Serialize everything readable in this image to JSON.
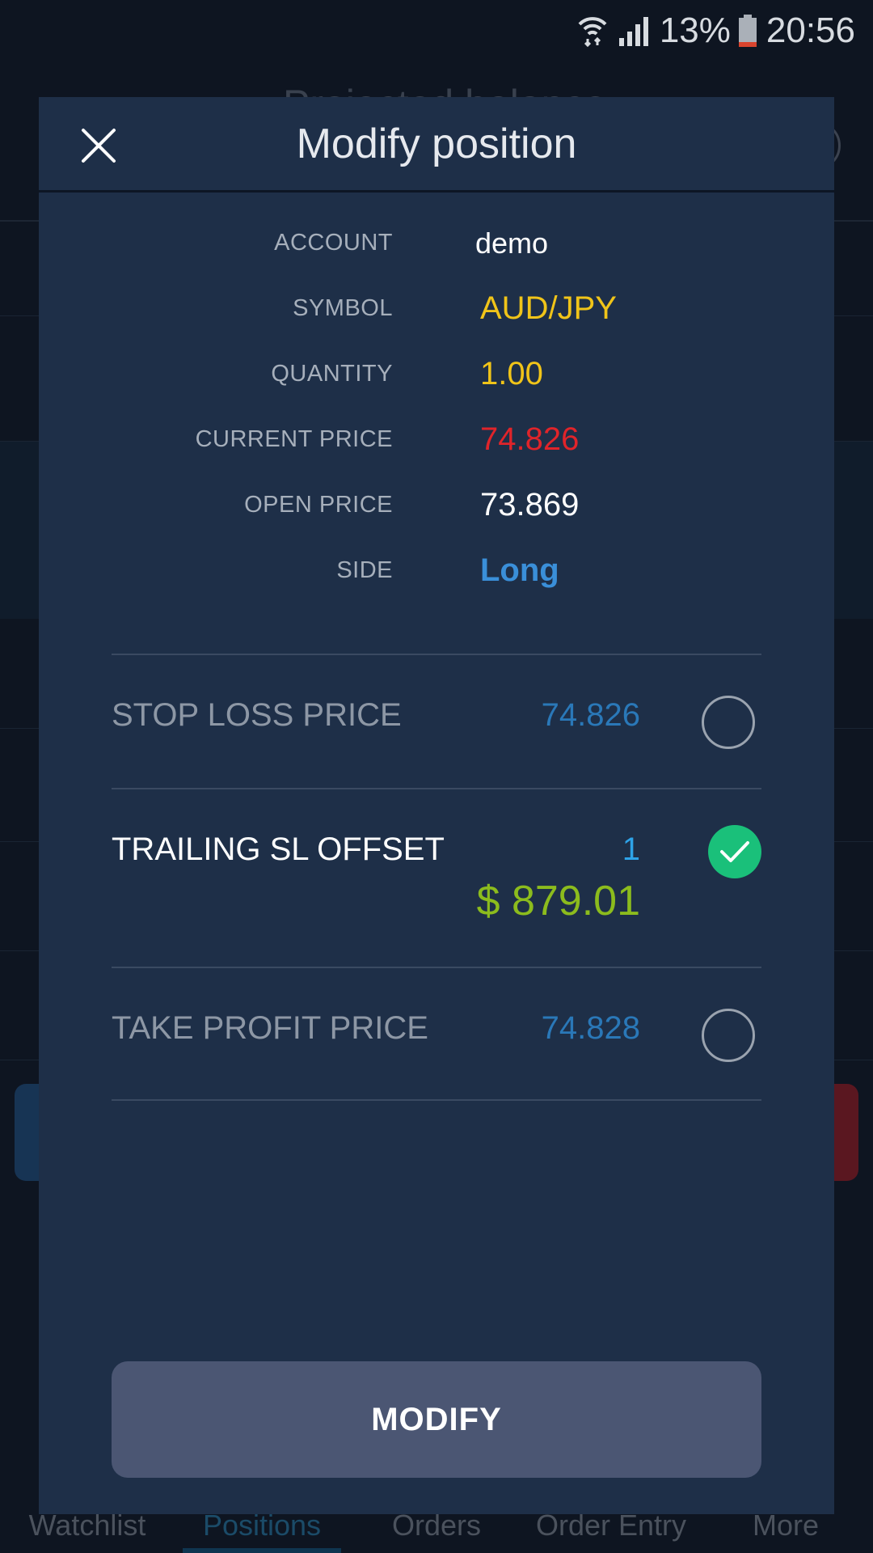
{
  "status_bar": {
    "battery": "13%",
    "time": "20:56"
  },
  "background": {
    "header_title": "Projected balance"
  },
  "modal": {
    "title": "Modify position",
    "info": [
      {
        "label": "ACCOUNT",
        "value": "demo"
      },
      {
        "label": "SYMBOL",
        "value": "AUD/JPY"
      },
      {
        "label": "QUANTITY",
        "value": "1.00"
      },
      {
        "label": "CURRENT PRICE",
        "value": "74.826"
      },
      {
        "label": "OPEN PRICE",
        "value": "73.869"
      },
      {
        "label": "SIDE",
        "value": "Long"
      }
    ],
    "stop_loss": {
      "label": "STOP LOSS PRICE",
      "value": "74.826",
      "checked": false
    },
    "trailing_sl": {
      "label": "TRAILING SL OFFSET",
      "value": "1",
      "amount": "$ 879.01",
      "checked": true
    },
    "take_profit": {
      "label": "TAKE PROFIT PRICE",
      "value": "74.828",
      "checked": false
    },
    "submit_label": "MODIFY"
  },
  "bottom_nav": {
    "items": [
      "Watchlist",
      "Positions",
      "Orders",
      "Order Entry",
      "More"
    ],
    "active": "Positions"
  },
  "colors": {
    "modal_bg": "#1e2f48",
    "symbol": "#f0c419",
    "current_price": "#e0242a",
    "side": "#3a8fd9",
    "amount": "#8cbc1d",
    "check": "#1ac07a",
    "button": "#4b5673"
  }
}
